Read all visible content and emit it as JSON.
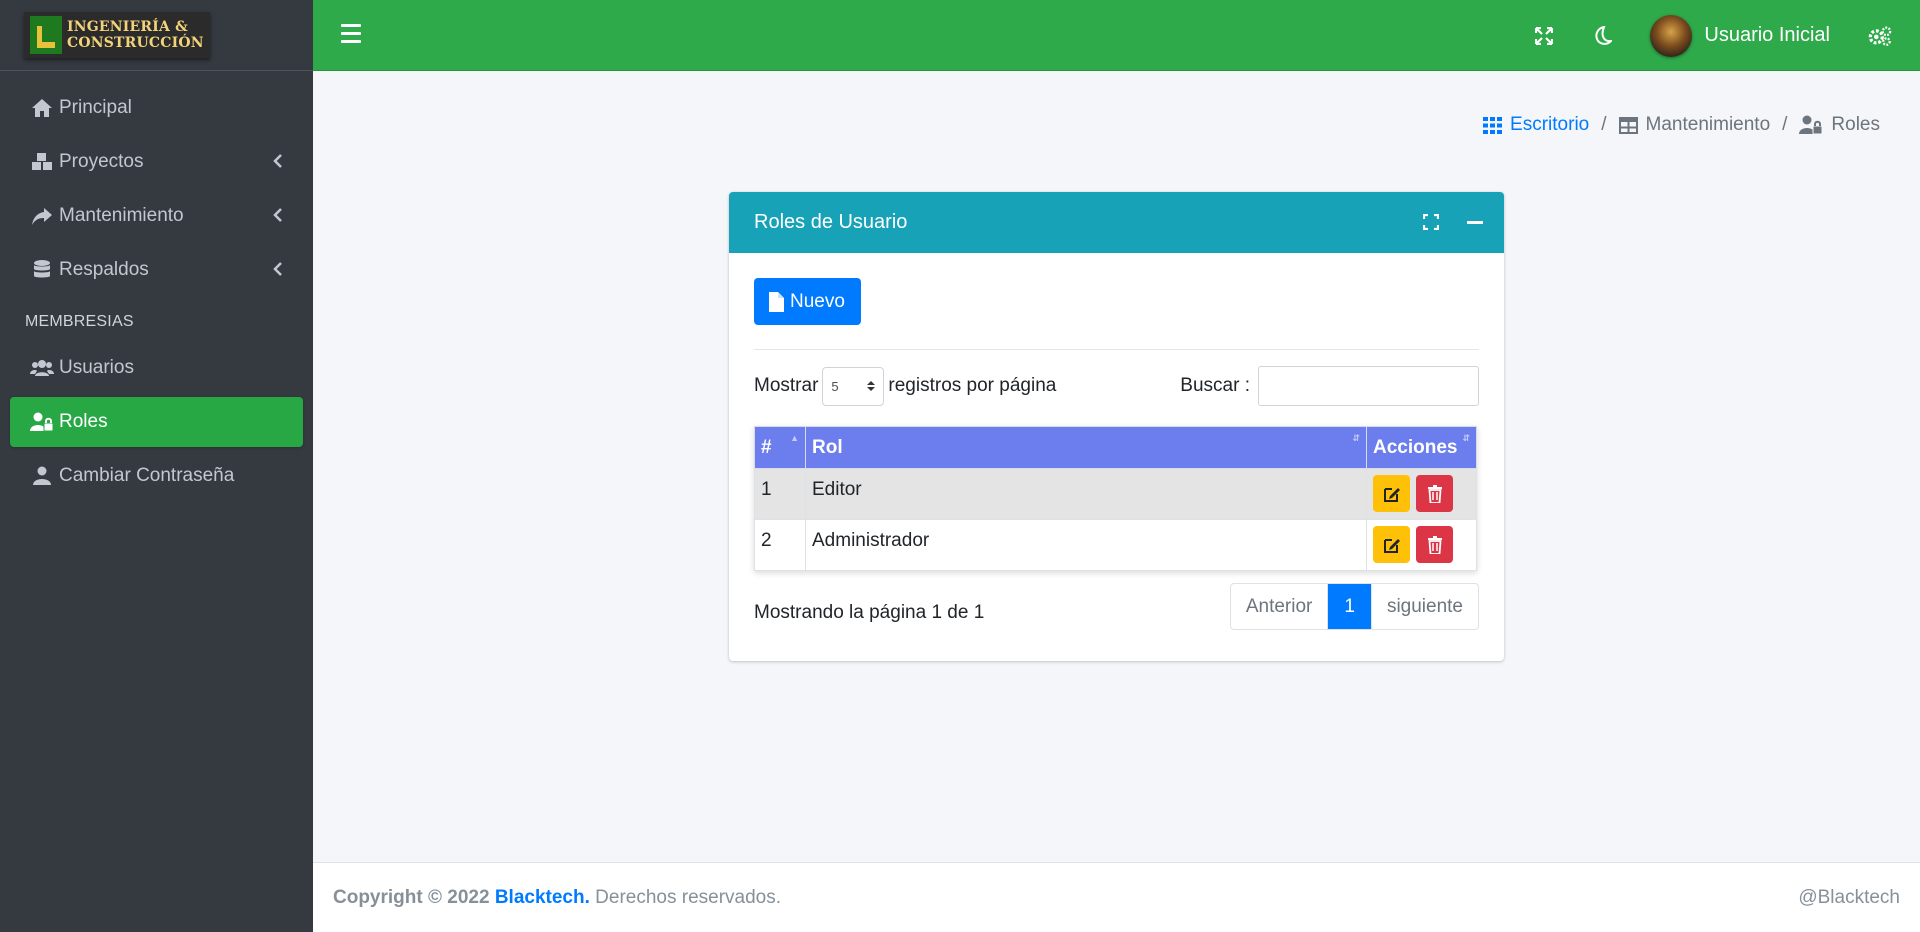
{
  "brand": {
    "line1": "INGENIERÍA &",
    "line2": "CONSTRUCCIÓN"
  },
  "sidebar": {
    "items": [
      {
        "label": "Principal",
        "icon": "home-icon"
      },
      {
        "label": "Proyectos",
        "icon": "cubes-icon"
      },
      {
        "label": "Mantenimiento",
        "icon": "share-icon"
      },
      {
        "label": "Respaldos",
        "icon": "database-icon"
      }
    ],
    "section_header": "MEMBRESIAS",
    "members": [
      {
        "label": "Usuarios",
        "icon": "users-icon"
      },
      {
        "label": "Roles",
        "icon": "user-lock-icon",
        "active": true
      },
      {
        "label": "Cambiar Contraseña",
        "icon": "user-icon"
      }
    ]
  },
  "topbar": {
    "user_name": "Usuario Inicial"
  },
  "breadcrumb": {
    "home": "Escritorio",
    "section": "Mantenimiento",
    "current": "Roles"
  },
  "card": {
    "title": "Roles de Usuario",
    "new_button": "Nuevo",
    "show_label": "Mostrar",
    "page_size": "5",
    "per_page_label": "registros por página",
    "search_label": "Buscar :",
    "search_value": "",
    "columns": [
      "#",
      "Rol",
      "Acciones"
    ],
    "rows": [
      {
        "num": "1",
        "role": "Editor"
      },
      {
        "num": "2",
        "role": "Administrador"
      }
    ],
    "info": "Mostrando la página 1 de 1",
    "pager": {
      "prev": "Anterior",
      "current": "1",
      "next": "siguiente"
    }
  },
  "footer": {
    "copyright": "Copyright © 2022",
    "company": "Blacktech.",
    "rights": "Derechos reservados.",
    "right_text": "@Blacktech"
  },
  "colors": {
    "topbar": "#2eaa4b",
    "sidebar": "#343a40",
    "active_nav": "#28a745",
    "card_header": "#17a2b8",
    "table_header": "#6c7ded",
    "primary": "#007bff",
    "edit": "#ffc107",
    "delete": "#dc3545"
  }
}
